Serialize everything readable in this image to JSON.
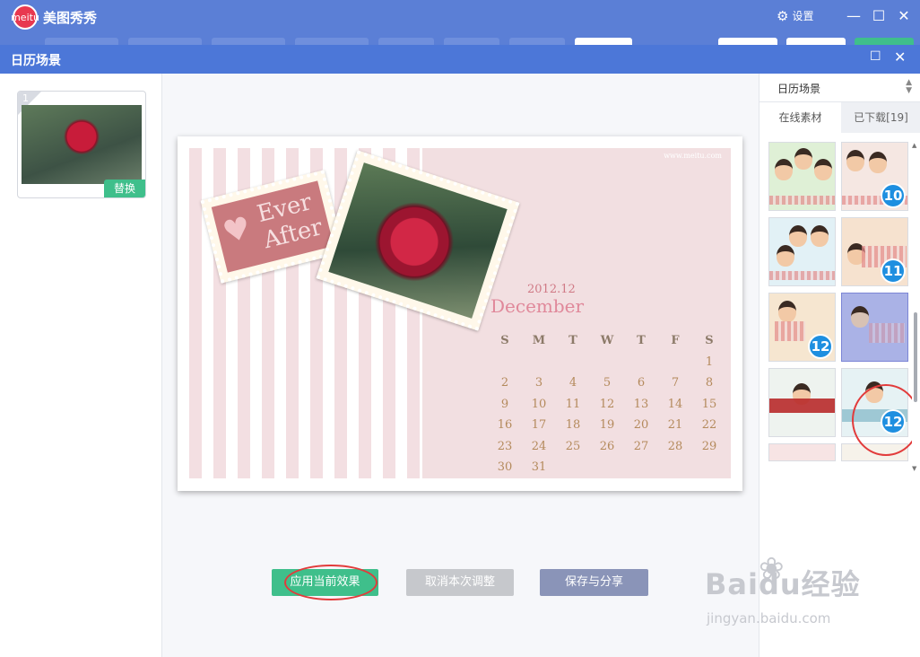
{
  "app": {
    "logo_text": "meitu",
    "name": "美图秀秀",
    "settings_label": "设置",
    "minimize": "—",
    "maximize": "☐",
    "close": "✕"
  },
  "dialog": {
    "title": "日历场景",
    "maximize": "☐",
    "close": "✕"
  },
  "photo_panel": {
    "thumb_number": "1",
    "replace_label": "替换"
  },
  "calendar": {
    "url": "www.meitu.com",
    "stamp_text_line1": "Ever",
    "stamp_text_line2": "After",
    "year_month": "2012.12",
    "month_name": "December",
    "weekdays": [
      "S",
      "M",
      "T",
      "W",
      "T",
      "F",
      "S"
    ],
    "weeks": [
      [
        "",
        "",
        "",
        "",
        "",
        "",
        "1"
      ],
      [
        "2",
        "3",
        "4",
        "5",
        "6",
        "7",
        "8"
      ],
      [
        "9",
        "10",
        "11",
        "12",
        "13",
        "14",
        "15"
      ],
      [
        "16",
        "17",
        "18",
        "19",
        "20",
        "21",
        "22"
      ],
      [
        "23",
        "24",
        "25",
        "26",
        "27",
        "28",
        "29"
      ],
      [
        "30",
        "31",
        "",
        "",
        "",
        "",
        ""
      ]
    ]
  },
  "actions": {
    "apply": "应用当前效果",
    "cancel": "取消本次调整",
    "save_share": "保存与分享"
  },
  "sidebar": {
    "scene_select": "日历场景",
    "tabs": [
      "在线素材",
      "已下载[19]"
    ],
    "templates": [
      {
        "badge": ""
      },
      {
        "badge": "10"
      },
      {
        "badge": ""
      },
      {
        "badge": "11"
      },
      {
        "badge": "12"
      },
      {
        "badge": ""
      },
      {
        "badge": ""
      },
      {
        "badge": "12"
      }
    ]
  },
  "watermark": {
    "main": "Baidu经验",
    "sub": "jingyan.baidu.com"
  },
  "colors": {
    "titlebar": "#5b7fd6",
    "dialog_titlebar": "#4c77d8",
    "apply_button": "#3fbf8b",
    "cancel_button": "#c6c8cc",
    "save_button": "#8a94b8",
    "badge": "#1e8fe0",
    "annotation_ring": "#e23b3b"
  }
}
